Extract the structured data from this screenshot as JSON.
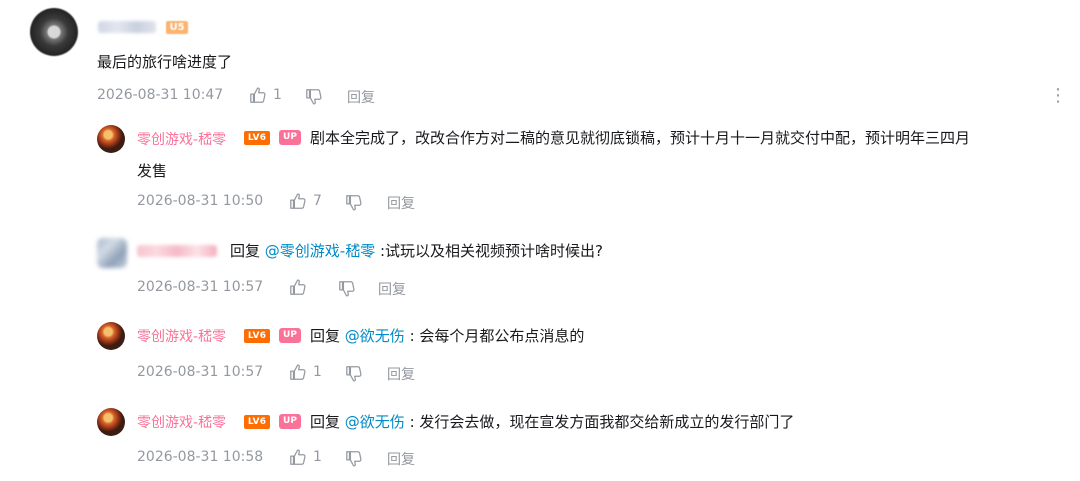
{
  "main_comment": {
    "user_level": "U5",
    "text": "最后的旅行啥进度了",
    "time": "2026-08-31 10:47",
    "likes": "1",
    "reply_label": "回复",
    "more_icon": "⋮"
  },
  "replies": [
    {
      "username": "零创游戏-嵇零",
      "level": "LV6",
      "up_badge": "UP",
      "text_line1": "剧本全完成了，改改合作方对二稿的意见就彻底锁稿，预计十月十一月就交付中配，预计明年三四月",
      "text_line2": "发售",
      "time": "2026-08-31 10:50",
      "likes": "7",
      "reply_label": "回复"
    },
    {
      "reply_prefix": "回复",
      "mention": "@零创游戏-嵇零",
      "text": " :试玩以及相关视频预计啥时候出?",
      "time": "2026-08-31 10:57",
      "likes": "",
      "reply_label": "回复"
    },
    {
      "username": "零创游戏-嵇零",
      "level": "LV6",
      "up_badge": "UP",
      "reply_prefix": "回复",
      "mention": "@欲无伤",
      "text": " : 会每个月都公布点消息的",
      "time": "2026-08-31 10:57",
      "likes": "1",
      "reply_label": "回复"
    },
    {
      "username": "零创游戏-嵇零",
      "level": "LV6",
      "up_badge": "UP",
      "reply_prefix": "回复",
      "mention": "@欲无伤",
      "text": " : 发行会去做，现在宣发方面我都交给新成立的发行部门了",
      "time": "2026-08-31 10:58",
      "likes": "1",
      "reply_label": "回复"
    }
  ],
  "icons": {
    "like": "thumbs-up-icon",
    "dislike": "thumbs-down-icon",
    "more": "more-vertical-icon"
  },
  "colors": {
    "username": "#fb7299",
    "mention": "#008ac5",
    "meta": "#9499a0",
    "level6": "#ff6c00",
    "up_badge": "#fb7299"
  }
}
